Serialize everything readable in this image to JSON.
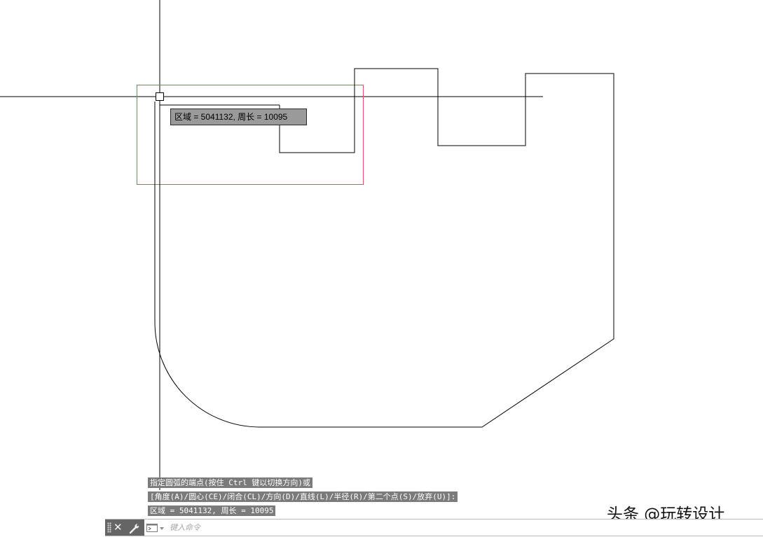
{
  "tooltip": {
    "text": "区域 = 5041132, 周长 = 10095"
  },
  "command_history": [
    "指定圆弧的端点(按住 Ctrl 键以切换方向)或",
    "[角度(A)/圆心(CE)/闭合(CL)/方向(D)/直线(L)/半径(R)/第二个点(S)/放弃(U)]:",
    "区域 = 5041132, 周长 = 10095"
  ],
  "command_line": {
    "placeholder": "键入命令",
    "close_icon": "close-icon",
    "customize_icon": "wrench-icon",
    "recent_commands_icon": "command-prompt-icon"
  },
  "watermark": "头条 @玩转设计",
  "colors": {
    "selection_box": "#e0535a",
    "geometry": "#000000",
    "command_bar_grip": "#656565",
    "history_background": "#7b7b7b"
  }
}
